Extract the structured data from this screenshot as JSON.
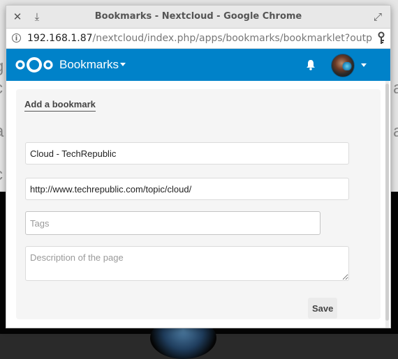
{
  "window": {
    "title": "Bookmarks - Nextcloud - Google Chrome",
    "close_glyph": "✕",
    "minimize_glyph": "⤓",
    "maximize_glyph": "⤢"
  },
  "addressbar": {
    "host": "192.168.1.87",
    "path": "/nextcloud/index.php/apps/bookmarks/bookmarklet?output=p",
    "info_icon": "info-icon",
    "key_icon": "key-icon"
  },
  "header": {
    "app_name": "Bookmarks",
    "brand_color": "#0082c9",
    "icons": [
      "nextcloud-logo-icon",
      "chevron-down-icon",
      "bell-icon",
      "avatar",
      "chevron-down-icon"
    ]
  },
  "form": {
    "heading": "Add a bookmark",
    "title_value": "Cloud - TechRepublic",
    "url_value": "http://www.techrepublic.com/topic/cloud/",
    "tags_placeholder": "Tags",
    "description_placeholder": "Description of the page",
    "save_label": "Save"
  },
  "background": {
    "left_letters": "g\nc\nt\na\nr\nc",
    "right_letters": "\na\n\na\n"
  }
}
